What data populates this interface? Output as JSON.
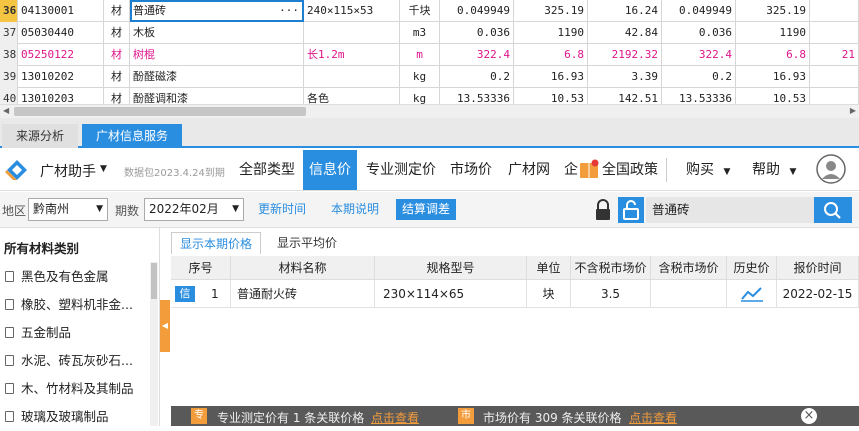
{
  "grid": {
    "rows": [
      {
        "rn": "36",
        "code": "04130001",
        "type": "材",
        "name": "普通砖",
        "spec": "240×115×53",
        "unit": "千块",
        "q1": "0.049949",
        "p1": "325.19",
        "t1": "16.24",
        "q2": "0.049949",
        "p2": "325.19",
        "extra": ""
      },
      {
        "rn": "37",
        "code": "05030440",
        "type": "材",
        "name": "木板",
        "spec": "",
        "unit": "m3",
        "q1": "0.036",
        "p1": "1190",
        "t1": "42.84",
        "q2": "0.036",
        "p2": "1190",
        "extra": ""
      },
      {
        "rn": "38",
        "code": "05250122",
        "type": "材",
        "name": "树棍",
        "spec": "长1.2m",
        "unit": "m",
        "q1": "322.4",
        "p1": "6.8",
        "t1": "2192.32",
        "q2": "322.4",
        "p2": "6.8",
        "extra": "21"
      },
      {
        "rn": "39",
        "code": "13010202",
        "type": "材",
        "name": "酚醛磁漆",
        "spec": "",
        "unit": "kg",
        "q1": "0.2",
        "p1": "16.93",
        "t1": "3.39",
        "q2": "0.2",
        "p2": "16.93",
        "extra": ""
      },
      {
        "rn": "40",
        "code": "13010203",
        "type": "材",
        "name": "酚醛调和漆",
        "spec": "各色",
        "unit": "kg",
        "q1": "13.53336",
        "p1": "10.53",
        "t1": "142.51",
        "q2": "13.53336",
        "p2": "10.53",
        "extra": ""
      }
    ],
    "ellipsis": "···"
  },
  "bottom_tabs": {
    "source": "来源分析",
    "info": "广材信息服务"
  },
  "toolbar": {
    "brand": "广材助手",
    "brand_arrow": "▼",
    "version": "数据包2023.4.24到期",
    "nav": [
      "全部类型",
      "信息价",
      "专业测定价",
      "市场价",
      "广材网",
      "企",
      "全国政策"
    ],
    "buy": "购买",
    "help": "帮助",
    "dropdown_arrow": "▼"
  },
  "filter": {
    "region_label": "地区",
    "region_value": "黔南州",
    "period_label": "期数",
    "period_value": "2022年02月",
    "update_time": "更新时间",
    "period_note": "本期说明",
    "settle_adjust": "结算调差",
    "search_value": "普通砖"
  },
  "left_panel": {
    "title": "所有材料类别",
    "categories": [
      "黑色及有色金属",
      "橡胶、塑料机非金...",
      "五金制品",
      "水泥、砖瓦灰砂石...",
      "木、竹材料及其制品",
      "玻璃及玻璃制品"
    ]
  },
  "right_panel": {
    "subtabs": [
      "显示本期价格",
      "显示平均价"
    ],
    "columns": [
      "序号",
      "材料名称",
      "规格型号",
      "单位",
      "不含税市场价",
      "含税市场价",
      "历史价",
      "报价时间"
    ],
    "rows": [
      {
        "badge": "信",
        "no": "1",
        "name": "普通耐火砖",
        "spec": "230×114×65",
        "unit": "块",
        "price_ex": "3.5",
        "price_in": "",
        "date": "2022-02-15"
      }
    ]
  },
  "status_bar": {
    "badge1": "专",
    "text1": "专业测定价有 1 条关联价格",
    "link1": "点击查看",
    "badge2": "市",
    "text2": "市场价有 309 条关联价格",
    "link2": "点击查看",
    "close": "×"
  },
  "colors": {
    "accent": "#2a8ee0",
    "highlight_row": "#e0148c",
    "orange": "#f39c3c",
    "statusbar": "#595959"
  }
}
